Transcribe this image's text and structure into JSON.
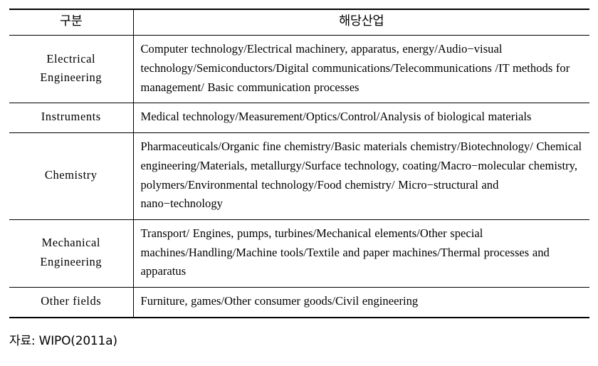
{
  "table": {
    "headers": {
      "category": "구분",
      "industry": "해당산업"
    },
    "rows": [
      {
        "category": "Electrical\nEngineering",
        "industry": "Computer technology/Electrical machinery, apparatus, energy/Audio−visual technology/Semiconductors/Digital communications/Telecommunications /IT methods for management/ Basic communication processes"
      },
      {
        "category": "Instruments",
        "industry": "Medical technology/Measurement/Optics/Control/Analysis of biological materials"
      },
      {
        "category": "Chemistry",
        "industry": "Pharmaceuticals/Organic fine chemistry/Basic materials chemistry/Biotechnology/ Chemical engineering/Materials, metallurgy/Surface technology, coating/Macro−molecular chemistry, polymers/Environmental technology/Food chemistry/ Micro−structural and nano−technology"
      },
      {
        "category": "Mechanical\nEngineering",
        "industry": "Transport/ Engines, pumps, turbines/Mechanical elements/Other special machines/Handling/Machine tools/Textile and paper machines/Thermal processes and apparatus"
      },
      {
        "category": "Other fields",
        "industry": "Furniture, games/Other consumer goods/Civil engineering"
      }
    ]
  },
  "footer": {
    "source": "자료: WIPO(2011a)"
  }
}
